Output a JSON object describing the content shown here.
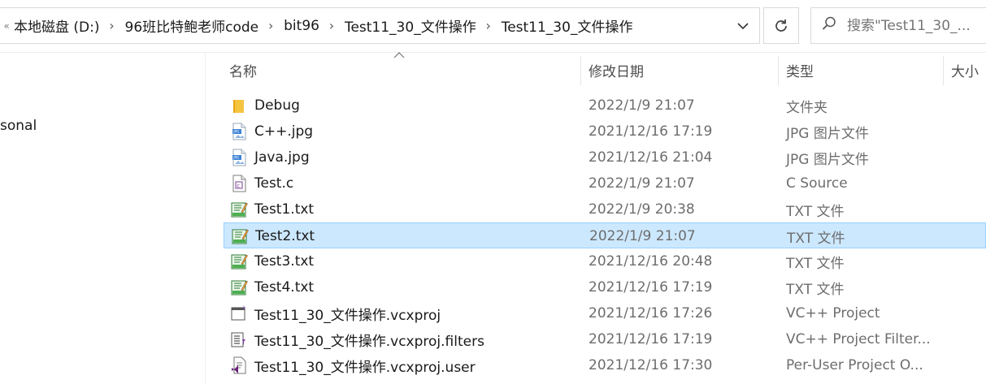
{
  "address_bar": {
    "overflow_glyph": "«",
    "crumbs": [
      "本地磁盘 (D:)",
      "96班比特鲍老师code",
      "bit96",
      "Test11_30_文件操作",
      "Test11_30_文件操作"
    ],
    "separator": "›"
  },
  "search": {
    "placeholder": "搜索\"Test11_30_..."
  },
  "nav_pane": {
    "items": [
      {
        "label": "sonal"
      }
    ]
  },
  "columns": {
    "name": "名称",
    "date": "修改日期",
    "type": "类型",
    "size": "大小"
  },
  "files": [
    {
      "name": "Debug",
      "date": "2022/1/9 21:07",
      "type": "文件夹",
      "icon": "folder-icon"
    },
    {
      "name": "C++.jpg",
      "date": "2021/12/16 17:19",
      "type": "JPG 图片文件",
      "icon": "jpg-file-icon"
    },
    {
      "name": "Java.jpg",
      "date": "2021/12/16 21:04",
      "type": "JPG 图片文件",
      "icon": "jpg-file-icon"
    },
    {
      "name": "Test.c",
      "date": "2022/1/9 21:07",
      "type": "C Source",
      "icon": "c-source-file-icon"
    },
    {
      "name": "Test1.txt",
      "date": "2022/1/9 20:38",
      "type": "TXT 文件",
      "icon": "txt-file-icon"
    },
    {
      "name": "Test2.txt",
      "date": "2022/1/9 21:07",
      "type": "TXT 文件",
      "icon": "txt-file-icon",
      "selected": true
    },
    {
      "name": "Test3.txt",
      "date": "2021/12/16 20:48",
      "type": "TXT 文件",
      "icon": "txt-file-icon"
    },
    {
      "name": "Test4.txt",
      "date": "2021/12/16 17:19",
      "type": "TXT 文件",
      "icon": "txt-file-icon"
    },
    {
      "name": "Test11_30_文件操作.vcxproj",
      "date": "2021/12/16 17:26",
      "type": "VC++ Project",
      "icon": "vcxproj-file-icon"
    },
    {
      "name": "Test11_30_文件操作.vcxproj.filters",
      "date": "2021/12/16 17:19",
      "type": "VC++ Project Filter...",
      "icon": "vcxproj-filters-file-icon"
    },
    {
      "name": "Test11_30_文件操作.vcxproj.user",
      "date": "2021/12/16 17:30",
      "type": "Per-User Project O...",
      "icon": "vcxproj-user-file-icon"
    }
  ],
  "colors": {
    "selection_bg": "#cce8ff",
    "selection_border": "#99d1ff",
    "folder": "#f5c542",
    "jpg": "#3b82d6",
    "txt_green": "#4caf50"
  }
}
